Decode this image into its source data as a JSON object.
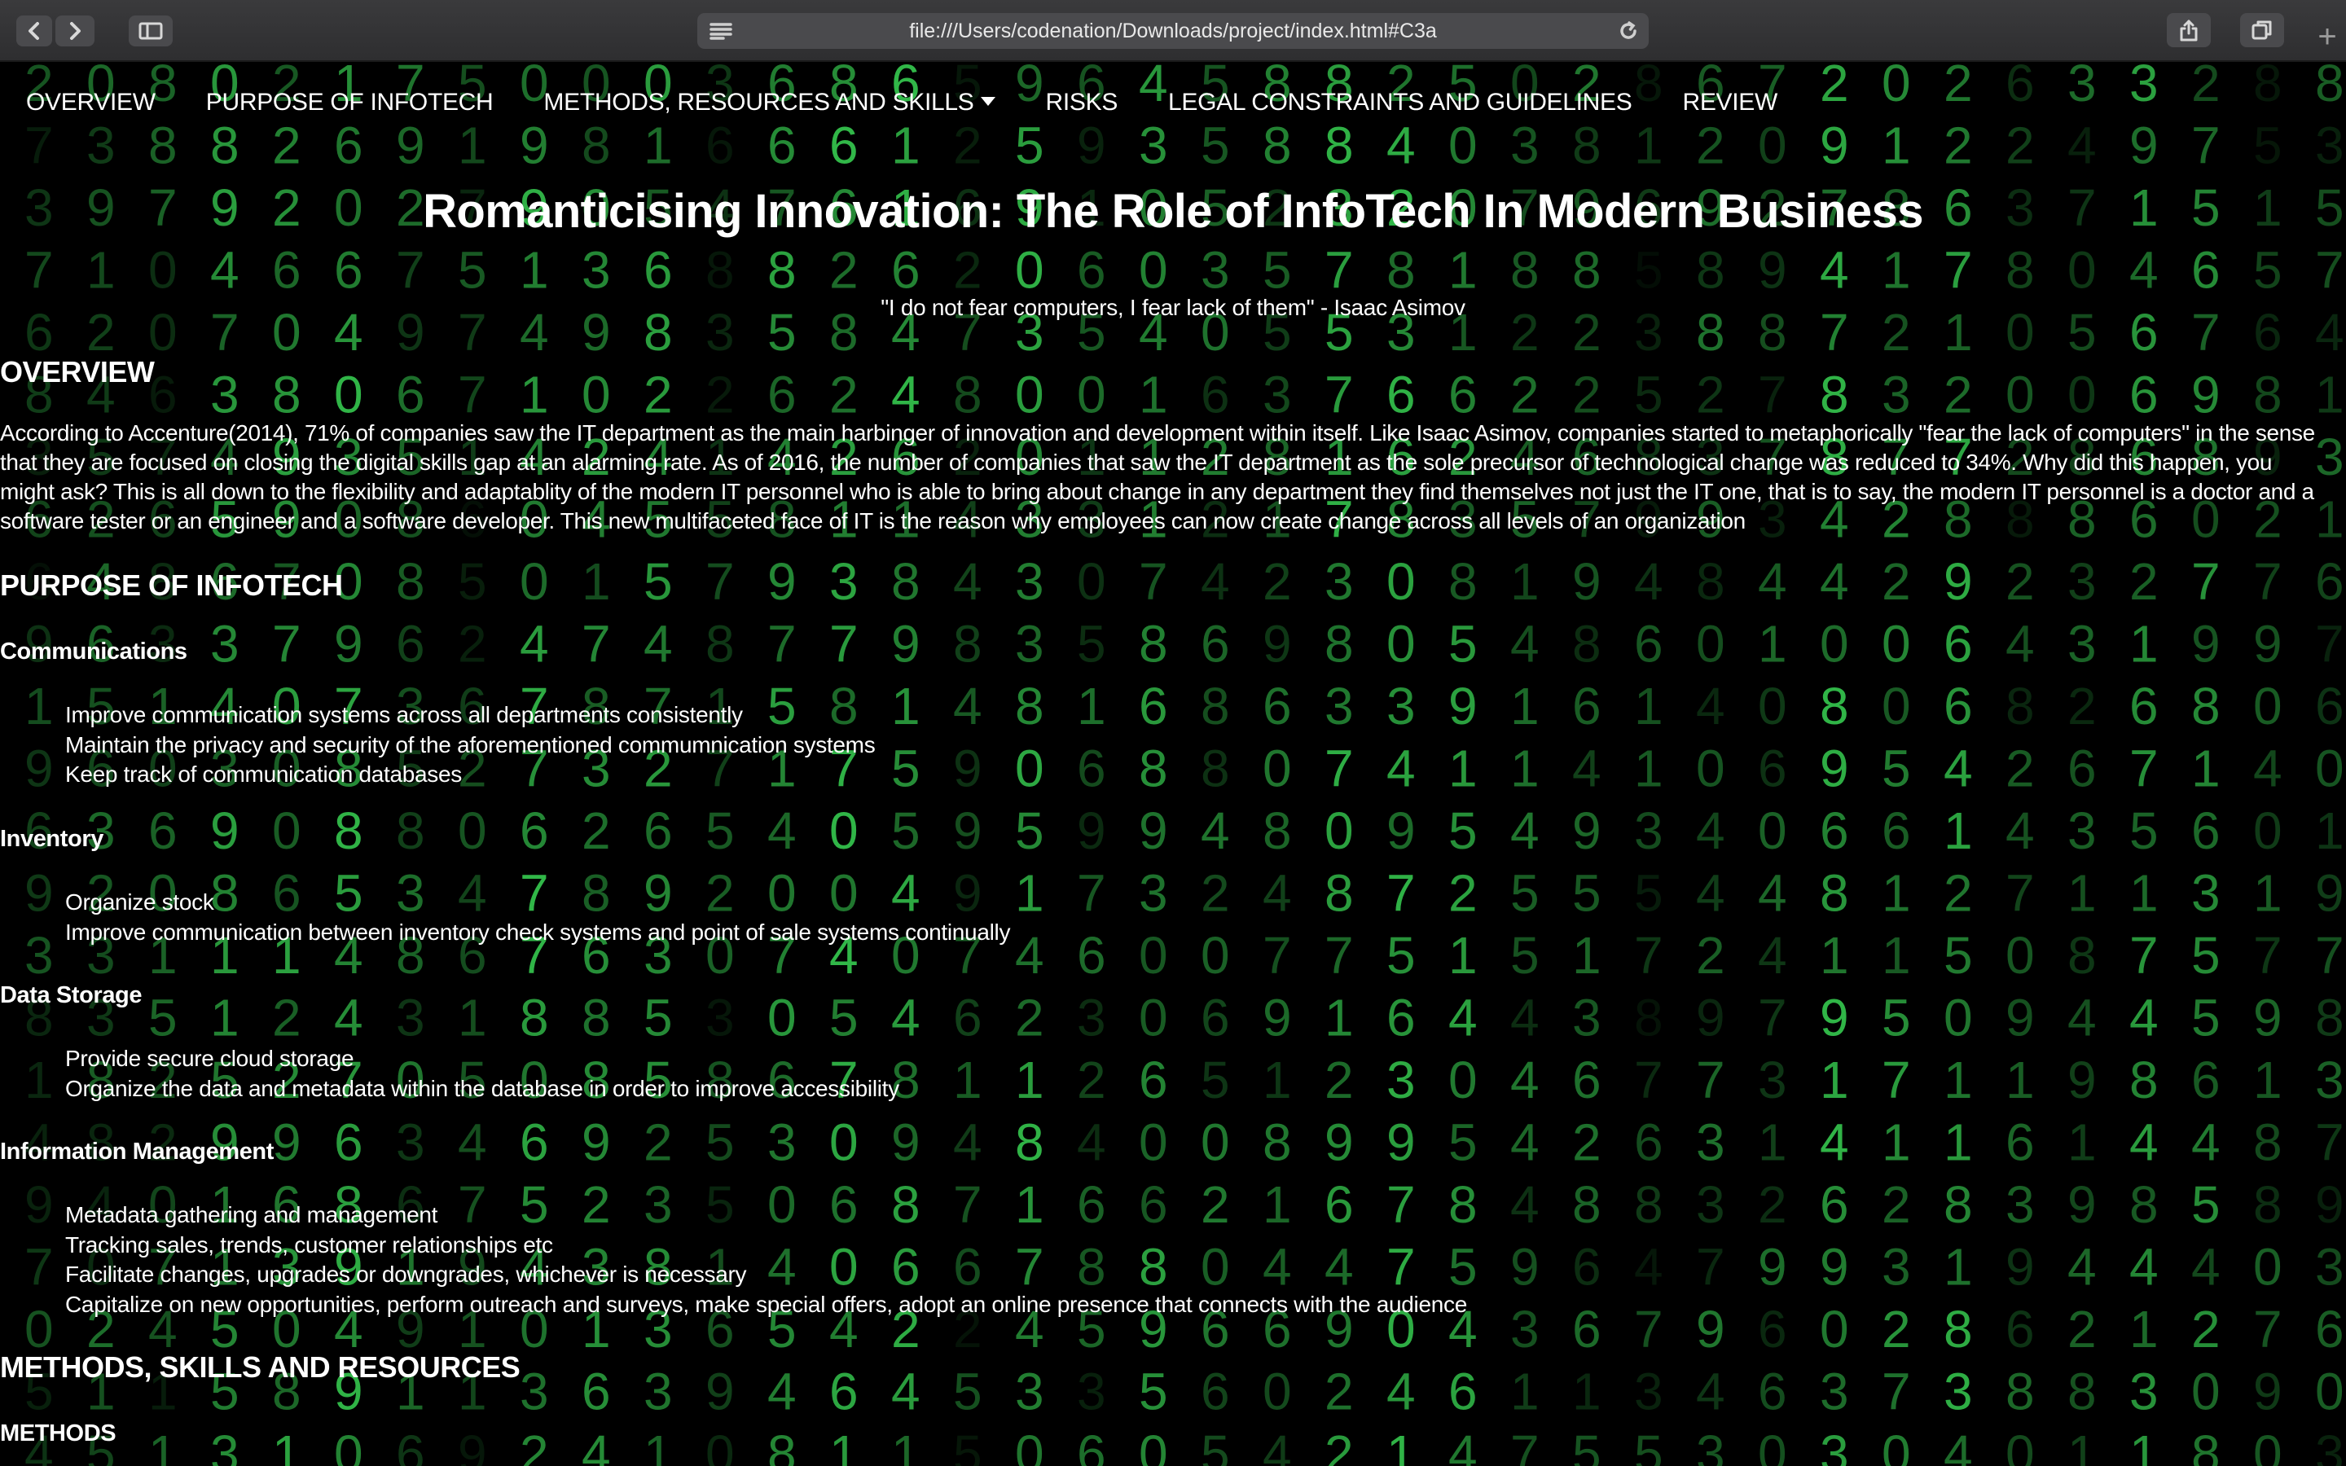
{
  "browser": {
    "url": "file:///Users/codenation/Downloads/project/index.html#C3a",
    "back_icon": "chevron-left-icon",
    "forward_icon": "chevron-right-icon",
    "sidebar_icon": "sidebar-icon",
    "reader_icon": "reader-lines-icon",
    "reload_icon": "reload-icon",
    "share_icon": "share-icon",
    "tabs_icon": "tabs-icon",
    "new_tab": "+"
  },
  "nav": {
    "items": [
      {
        "label": "OVERVIEW"
      },
      {
        "label": "PURPOSE OF INFOTECH"
      },
      {
        "label": "METHODS, RESOURCES AND SKILLS"
      },
      {
        "label": "RISKS"
      },
      {
        "label": "LEGAL CONSTRAINTS AND GUIDELINES"
      },
      {
        "label": "REVIEW"
      }
    ]
  },
  "page": {
    "title": "Romanticising Innovation: The Role of InfoTech In Modern Business",
    "quote": "\"I do not fear computers, I fear lack of them\" - Isaac Asimov",
    "overview": {
      "heading": "OVERVIEW",
      "text": "According to Accenture(2014), 71% of companies saw the IT department as the main harbinger of innovation and development within itself. Like Isaac Asimov, companies started to metaphorically \"fear the lack of computers\" in the sense that they are focused on closing the digital skills gap at an alarming rate. As of 2016, the number of companies that saw the IT department as the sole precursor of technological change was reduced to 34%. Why did this happen, you might ask? This is all down to the flexibility and adaptablity of the modern IT personnel who is able to bring about change in any department they find themselves not just the IT one, that is to say, the modern IT personnel is a doctor and a software tester or an engineer and a software developer. This new multifaceted face of IT is the reason why employees can now create change across all levels of an organization"
    },
    "purpose": {
      "heading": "PURPOSE OF INFOTECH",
      "sections": [
        {
          "title": "Communications",
          "items": [
            "Improve communication systems across all departments consistently",
            "Maintain the privacy and security of the aforementioned commumnication systems",
            "Keep track of communication databases"
          ]
        },
        {
          "title": "Inventory",
          "items": [
            "Organize stock",
            "Improve communication between inventory check systems and point of sale systems continually"
          ]
        },
        {
          "title": "Data Storage",
          "items": [
            "Provide secure cloud storage",
            "Organize the data and metadata within the database in order to improve accessibility"
          ]
        },
        {
          "title": "Information Management",
          "items": [
            "Metadata gathering and management",
            "Tracking sales, trends, customer relationships etc",
            "Facilitate changes, upgrades or downgrades, whichever is necessary",
            "Capitalize on new opportunities, perform outreach and surveys, make special offers, adopt an online presence that connects with the audience"
          ]
        }
      ]
    },
    "methods": {
      "heading": "METHODS, SKILLS AND RESOURCES",
      "subheading": "METHODS"
    }
  },
  "theme": {
    "digit_color": "#39d353",
    "background": "#000000"
  }
}
